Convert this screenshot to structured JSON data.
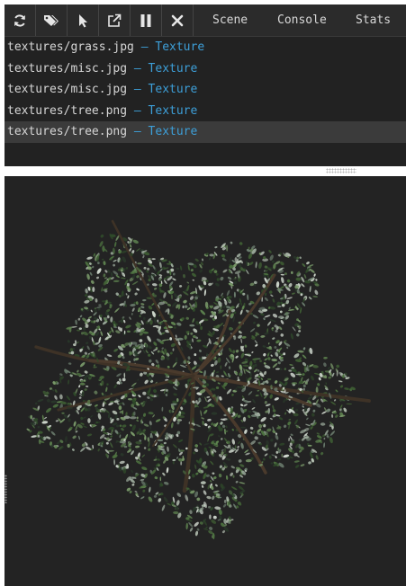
{
  "toolbar": {
    "buttons": [
      {
        "name": "refresh-icon"
      },
      {
        "name": "tags-icon"
      },
      {
        "name": "pointer-icon"
      },
      {
        "name": "external-link-icon"
      },
      {
        "name": "pause-icon"
      },
      {
        "name": "close-icon"
      }
    ],
    "tabs": [
      {
        "label": "Scene"
      },
      {
        "label": "Console"
      },
      {
        "label": "Stats"
      }
    ]
  },
  "log": {
    "separator": "–",
    "entries": [
      {
        "path": "textures/grass.jpg",
        "type": "Texture"
      },
      {
        "path": "textures/misc.jpg",
        "type": "Texture"
      },
      {
        "path": "textures/misc.jpg",
        "type": "Texture"
      },
      {
        "path": "textures/tree.png",
        "type": "Texture"
      },
      {
        "path": "textures/tree.png",
        "type": "Texture",
        "selected": true
      }
    ]
  },
  "viewport": {
    "background": "#232323",
    "scene": "tree-canopy-top-view"
  },
  "colors": {
    "panel_bg": "#222222",
    "accent": "#3d9fd8",
    "text": "#d6d6d6",
    "selected_row": "#3b3b3b"
  }
}
